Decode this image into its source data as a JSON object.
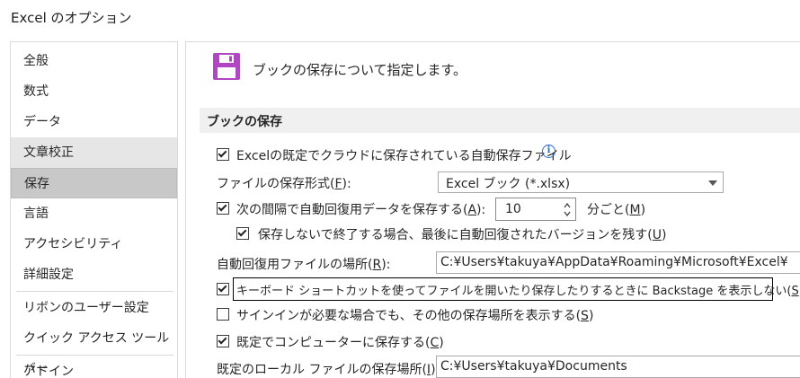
{
  "window": {
    "title": "Excel のオプション"
  },
  "sidebar": {
    "items": [
      {
        "label": "全般"
      },
      {
        "label": "数式"
      },
      {
        "label": "データ"
      },
      {
        "label": "文章校正"
      },
      {
        "label": "保存"
      },
      {
        "label": "言語"
      },
      {
        "label": "アクセシビリティ"
      },
      {
        "label": "詳細設定"
      },
      {
        "label": "リボンのユーザー設定"
      },
      {
        "label": "クイック アクセス ツール バー"
      },
      {
        "label": "アドイン"
      }
    ],
    "hovered": "文章校正",
    "selected": "保存"
  },
  "main": {
    "header": "ブックの保存について指定します。",
    "section_title": "ブックの保存",
    "autosave_default": {
      "label": "Excelの既定でクラウドに保存されている自動保存ファイル",
      "checked": true
    },
    "file_format": {
      "label": "ファイルの保存形式(",
      "key": "F",
      "suffix": "):",
      "value": "Excel ブック (*.xlsx)"
    },
    "autorecover_interval": {
      "label": "次の間隔で自動回復用データを保存する(",
      "key": "A",
      "suffix": "):",
      "checked": true,
      "value": "10",
      "unit_prefix": "分ごと(",
      "unit_key": "M",
      "unit_suffix": ")"
    },
    "keep_last_autosaved": {
      "label": "保存しないで終了する場合、最後に自動回復されたバージョンを残す(",
      "key": "U",
      "suffix": ")",
      "checked": true
    },
    "autorecover_location": {
      "label": "自動回復用ファイルの場所(",
      "key": "R",
      "suffix": "):",
      "value": "C:¥Users¥takuya¥AppData¥Roaming¥Microsoft¥Excel¥"
    },
    "no_backstage": {
      "label": "キーボード ショートカットを使ってファイルを開いたり保存したりするときに Backstage を表示しない(",
      "key": "S",
      "suffix": ")",
      "checked": true
    },
    "show_additional_places": {
      "label": "サインインが必要な場合でも、その他の保存場所を表示する(",
      "key": "S",
      "suffix": ")",
      "checked": false
    },
    "save_to_computer": {
      "label": "既定でコンピューターに保存する(",
      "key": "C",
      "suffix": ")",
      "checked": true
    },
    "default_local_location": {
      "label": "既定のローカル ファイルの保存場所(",
      "key": "I",
      "suffix": "):",
      "value": "C:¥Users¥takuya¥Documents"
    }
  },
  "colors": {
    "selected_bg": "#c8c8c8",
    "hover_bg": "#e6e6e6",
    "section_bg": "#f0f0f0",
    "save_icon": "#b146c2",
    "info_icon": "#2b6cc4"
  },
  "icons": {
    "header": "floppy-disk-icon",
    "info": "info-icon",
    "dropdown": "chevron-down-icon"
  }
}
